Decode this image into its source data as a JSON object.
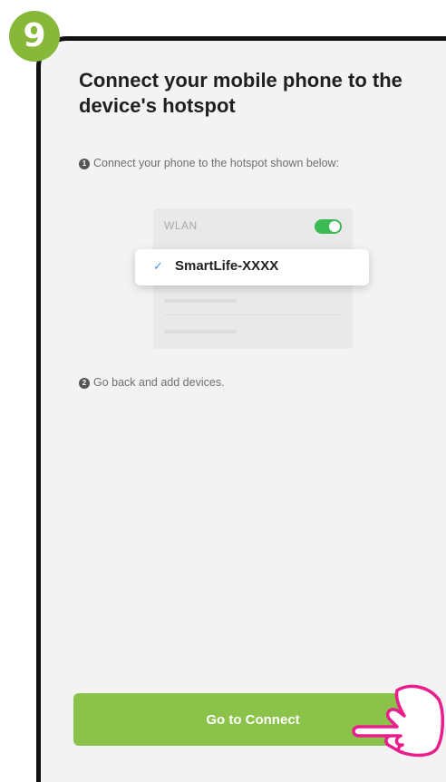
{
  "step": {
    "number": "9",
    "color": "#87b83a"
  },
  "title": "Connect your mobile phone to the device's hotspot",
  "instructions": [
    {
      "num": "1",
      "text": "Connect your phone to the hotspot shown below:"
    },
    {
      "num": "2",
      "text": "Go back and add devices."
    }
  ],
  "illustration": {
    "wlan_label": "WLAN",
    "wlan_toggle_on": true,
    "network": {
      "check_icon": "✓",
      "name": "SmartLife-XXXX"
    }
  },
  "button": {
    "label": "Go to Connect",
    "color": "#8bc34a"
  },
  "pointer": {
    "icon": "pointing-hand-icon",
    "color": "#e91e8c"
  }
}
